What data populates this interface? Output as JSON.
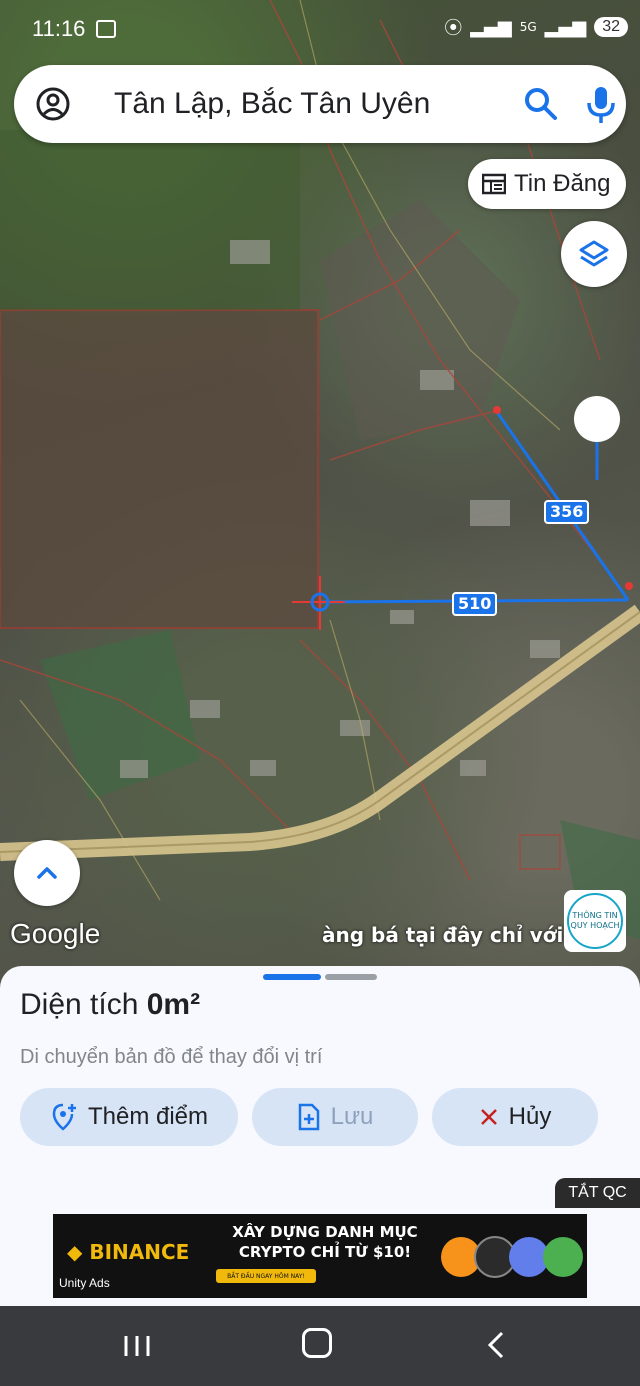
{
  "status_bar": {
    "time": "11:16",
    "network": "5G",
    "battery": "32"
  },
  "search": {
    "query": "Tân Lập, Bắc Tân Uyên"
  },
  "map": {
    "tin_dang_label": "Tin Đăng",
    "measurements": [
      "356",
      "510"
    ],
    "google_logo": "Google",
    "ad_marquee": "àng bá tại đây chỉ với 19",
    "planning_logo": [
      "THÔNG TIN",
      "QUY HOẠCH"
    ]
  },
  "sheet": {
    "area_label": "Diện tích",
    "area_value": "0m²",
    "hint": "Di chuyển bản đồ để thay đổi vị trí",
    "add_point_label": "Thêm điểm",
    "save_label": "Lưu",
    "cancel_label": "Hủy",
    "turn_off_ads": "TẮT QC"
  },
  "ad_banner": {
    "brand": "BINANCE",
    "headline": "XÂY DỰNG DANH MỤC CRYPTO CHỈ TỪ $10!",
    "cta": "BẮT ĐẦU NGAY HÔM NAY!",
    "provider": "Unity Ads"
  },
  "colors": {
    "accent": "#1a73e8",
    "button_bg": "#d6e4f6",
    "cancel_x": "#c5221f",
    "binance": "#f0b90b"
  }
}
